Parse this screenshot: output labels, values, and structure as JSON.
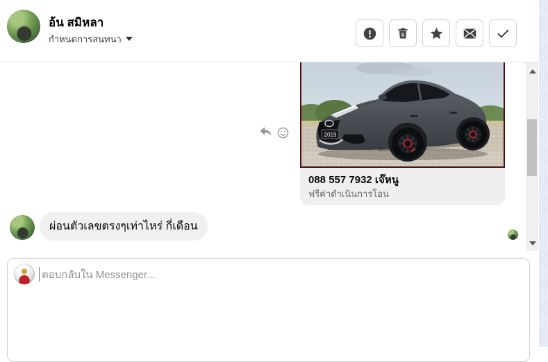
{
  "header": {
    "name": "อ้น สมิหลา",
    "conversation_menu_label": "กำหนดการสนทนา",
    "actions": [
      {
        "label": "report",
        "icon": "exclamation-circle-icon"
      },
      {
        "label": "delete",
        "icon": "trash-icon"
      },
      {
        "label": "star",
        "icon": "star-icon"
      },
      {
        "label": "mark-as-unread",
        "icon": "envelope-icon"
      },
      {
        "label": "mark-as-done",
        "icon": "check-icon"
      }
    ]
  },
  "chat": {
    "attachment": {
      "title": "088 557 7932 เจ๊หนู",
      "subtitle": "ฟรีค่าดำเนินการโอน",
      "image_description": "gray Mazda sedan parked on gravel lot with trees behind",
      "plate_badge": "2019"
    },
    "incoming_message": {
      "text": "ผ่อนตัวเลขตรงๆเท่าไหร่ กี่เดือน"
    },
    "hover_icons": [
      "reply-icon",
      "emoji-smile-icon"
    ]
  },
  "composer": {
    "placeholder": "ตอบกลับใน Messenger..."
  },
  "colors": {
    "photo_frame": "#4c0e10",
    "bubble_bg": "#f0f0f1",
    "attachment_card_bg": "#efeff1",
    "edge_strip": "#dbe2f4",
    "wheel_accent_red": "#b3242b",
    "car_body": "#4d5359"
  }
}
